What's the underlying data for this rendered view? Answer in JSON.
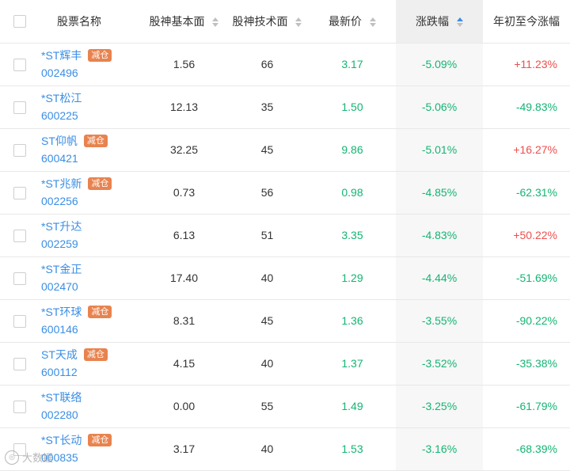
{
  "header": {
    "name_col": "股票名称",
    "fundamental_col": "股神基本面",
    "technical_col": "股神技术面",
    "price_col": "最新价",
    "change_col": "涨跌幅",
    "ytd_col": "年初至今涨幅"
  },
  "sort": {
    "column": "涨跌幅",
    "direction": "ascending"
  },
  "colors": {
    "up": "#ee4e4e",
    "down": "#14b473",
    "link": "#3a8ee6",
    "badge": "#e8834f"
  },
  "rows": [
    {
      "name": "*ST辉丰",
      "code": "002496",
      "badge": "减仓",
      "fundamental": "1.56",
      "technical": "66",
      "price": "3.17",
      "change": "-5.09%",
      "ytd": "+11.23%",
      "ytd_dir": "up"
    },
    {
      "name": "*ST松江",
      "code": "600225",
      "badge": "",
      "fundamental": "12.13",
      "technical": "35",
      "price": "1.50",
      "change": "-5.06%",
      "ytd": "-49.83%",
      "ytd_dir": "down"
    },
    {
      "name": "ST仰帆",
      "code": "600421",
      "badge": "减仓",
      "fundamental": "32.25",
      "technical": "45",
      "price": "9.86",
      "change": "-5.01%",
      "ytd": "+16.27%",
      "ytd_dir": "up"
    },
    {
      "name": "*ST兆新",
      "code": "002256",
      "badge": "减仓",
      "fundamental": "0.73",
      "technical": "56",
      "price": "0.98",
      "change": "-4.85%",
      "ytd": "-62.31%",
      "ytd_dir": "down"
    },
    {
      "name": "*ST升达",
      "code": "002259",
      "badge": "",
      "fundamental": "6.13",
      "technical": "51",
      "price": "3.35",
      "change": "-4.83%",
      "ytd": "+50.22%",
      "ytd_dir": "up"
    },
    {
      "name": "*ST金正",
      "code": "002470",
      "badge": "",
      "fundamental": "17.40",
      "technical": "40",
      "price": "1.29",
      "change": "-4.44%",
      "ytd": "-51.69%",
      "ytd_dir": "down"
    },
    {
      "name": "*ST环球",
      "code": "600146",
      "badge": "减仓",
      "fundamental": "8.31",
      "technical": "45",
      "price": "1.36",
      "change": "-3.55%",
      "ytd": "-90.22%",
      "ytd_dir": "down"
    },
    {
      "name": "ST天成",
      "code": "600112",
      "badge": "减仓",
      "fundamental": "4.15",
      "technical": "40",
      "price": "1.37",
      "change": "-3.52%",
      "ytd": "-35.38%",
      "ytd_dir": "down"
    },
    {
      "name": "*ST联络",
      "code": "002280",
      "badge": "",
      "fundamental": "0.00",
      "technical": "55",
      "price": "1.49",
      "change": "-3.25%",
      "ytd": "-61.79%",
      "ytd_dir": "down"
    },
    {
      "name": "*ST长动",
      "code": "000835",
      "badge": "减仓",
      "fundamental": "3.17",
      "technical": "40",
      "price": "1.53",
      "change": "-3.16%",
      "ytd": "-68.39%",
      "ytd_dir": "down"
    }
  ],
  "watermark": "大数据"
}
